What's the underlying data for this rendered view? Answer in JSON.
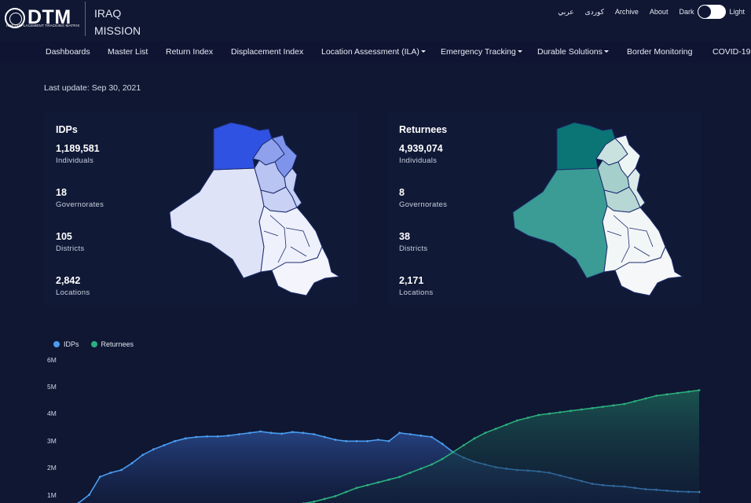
{
  "header": {
    "logo_text": "DTM",
    "logo_subtitle": "IOM DISPLACEMENT TRACKING MATRIX",
    "mission_line1": "IRAQ",
    "mission_line2": "MISSION",
    "links": [
      "عربي",
      "کوردی",
      "Archive",
      "About"
    ],
    "theme_dark_label": "Dark",
    "theme_light_label": "Light"
  },
  "nav": {
    "items": [
      {
        "label": "Dashboards",
        "dropdown": false
      },
      {
        "label": "Master List",
        "dropdown": false
      },
      {
        "label": "Return Index",
        "dropdown": false
      },
      {
        "label": "Displacement Index",
        "dropdown": false
      },
      {
        "label": "Location Assessment (ILA)",
        "dropdown": true
      },
      {
        "label": "Emergency Tracking",
        "dropdown": true
      },
      {
        "label": "Durable Solutions",
        "dropdown": true
      },
      {
        "label": "Border Monitoring",
        "dropdown": false
      },
      {
        "label": "COVID-19",
        "dropdown": false
      }
    ]
  },
  "last_update": "Last update: Sep 30, 2021",
  "cards": {
    "idps": {
      "title": "IDPs",
      "stats": [
        {
          "value": "1,189,581",
          "label": "Individuals"
        },
        {
          "value": "18",
          "label": "Governorates"
        },
        {
          "value": "105",
          "label": "Districts"
        },
        {
          "value": "2,842",
          "label": "Locations"
        }
      ]
    },
    "returnees": {
      "title": "Returnees",
      "stats": [
        {
          "value": "4,939,074",
          "label": "Individuals"
        },
        {
          "value": "8",
          "label": "Governorates"
        },
        {
          "value": "38",
          "label": "Districts"
        },
        {
          "value": "2,171",
          "label": "Locations"
        }
      ]
    }
  },
  "colors": {
    "background": "#0f1733",
    "idps_series": "#4a9cf0",
    "returnees_series": "#2bb07e",
    "idps_map_high": "#3358e8",
    "returnees_map_high": "#0a7474"
  },
  "chart_data": {
    "type": "area",
    "series": [
      {
        "name": "IDPs",
        "values": [
          0.8,
          1.1,
          1.75,
          1.9,
          2.0,
          2.25,
          2.55,
          2.75,
          2.9,
          3.05,
          3.15,
          3.2,
          3.22,
          3.22,
          3.25,
          3.3,
          3.35,
          3.4,
          3.35,
          3.32,
          3.38,
          3.35,
          3.3,
          3.2,
          3.1,
          3.05,
          3.05,
          3.05,
          3.1,
          3.05,
          3.35,
          3.3,
          3.25,
          3.2,
          2.95,
          2.65,
          2.45,
          2.3,
          2.2,
          2.1,
          2.05,
          2.0,
          1.98,
          1.95,
          1.9,
          1.8,
          1.7,
          1.6,
          1.5,
          1.45,
          1.42,
          1.4,
          1.35,
          1.3,
          1.28,
          1.25,
          1.22,
          1.21,
          1.2
        ]
      },
      {
        "name": "Returnees",
        "values": [
          null,
          null,
          null,
          null,
          null,
          null,
          null,
          null,
          null,
          null,
          null,
          null,
          null,
          null,
          null,
          null,
          null,
          null,
          null,
          null,
          0.72,
          0.78,
          0.85,
          0.95,
          1.05,
          1.2,
          1.35,
          1.45,
          1.55,
          1.65,
          1.75,
          1.9,
          2.05,
          2.2,
          2.4,
          2.65,
          2.9,
          3.15,
          3.35,
          3.5,
          3.65,
          3.8,
          3.9,
          4.0,
          4.05,
          4.1,
          4.15,
          4.2,
          4.25,
          4.3,
          4.35,
          4.4,
          4.5,
          4.6,
          4.7,
          4.75,
          4.8,
          4.85,
          4.9
        ]
      }
    ],
    "ytick_labels": [
      "6M",
      "5M",
      "4M",
      "3M",
      "2M",
      "1M"
    ],
    "ylim": [
      0,
      6
    ],
    "legend_position": "top-left",
    "grid": false
  }
}
